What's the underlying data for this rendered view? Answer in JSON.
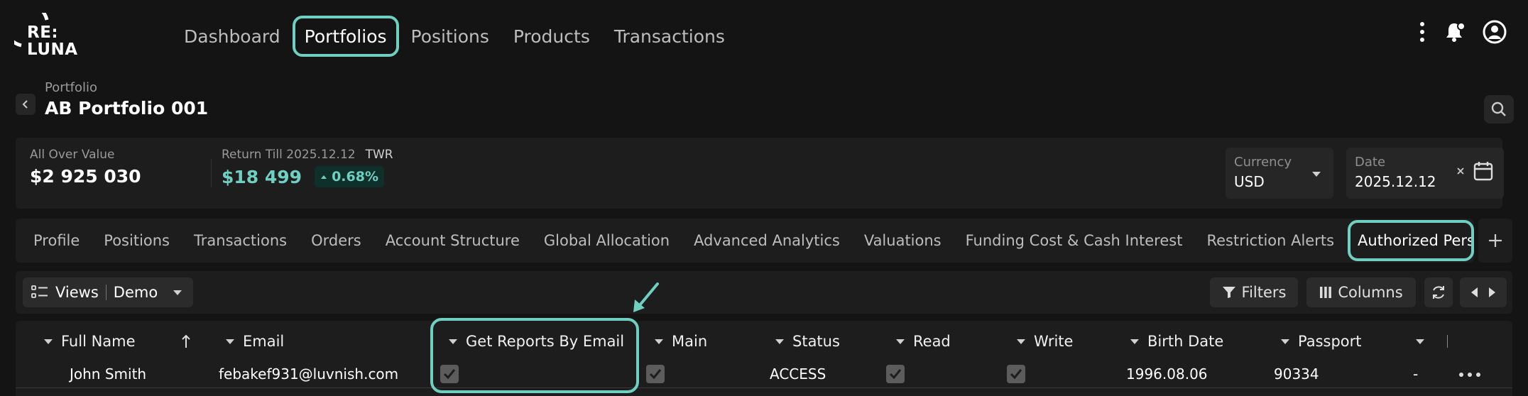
{
  "logo": {
    "line1": "RE:",
    "line2": "LUNA"
  },
  "nav": {
    "items": [
      "Dashboard",
      "Portfolios",
      "Positions",
      "Products",
      "Transactions"
    ],
    "active": "Portfolios"
  },
  "breadcrumb": {
    "parent": "Portfolio",
    "title": "AB Portfolio 001"
  },
  "summary": {
    "all_over_value_label": "All Over Value",
    "all_over_value": "$2 925 030",
    "return_label": "Return Till 2025.12.12",
    "return_type": "TWR",
    "return_value": "$18 499",
    "return_pct": "0.68%",
    "currency_label": "Currency",
    "currency_value": "USD",
    "date_label": "Date",
    "date_value": "2025.12.12"
  },
  "tabs": [
    "Profile",
    "Positions",
    "Transactions",
    "Orders",
    "Account Structure",
    "Global Allocation",
    "Advanced Analytics",
    "Valuations",
    "Funding Cost & Cash Interest",
    "Restriction Alerts",
    "Authorized Persons"
  ],
  "active_tab": "Authorized Persons",
  "toolbar": {
    "views_label": "Views",
    "views_value": "Demo",
    "filters_label": "Filters",
    "columns_label": "Columns"
  },
  "table": {
    "columns": [
      "Full Name",
      "Email",
      "Get Reports By Email",
      "Main",
      "Status",
      "Read",
      "Write",
      "Birth Date",
      "Passport"
    ],
    "rows": [
      {
        "full_name": "John Smith",
        "email": "febakef931@luvnish.com",
        "get_reports": true,
        "main": true,
        "status": "ACCESS",
        "read": true,
        "write": true,
        "birth_date": "1996.08.06",
        "passport": "90334",
        "extra": "-"
      }
    ]
  },
  "colors": {
    "accent": "#6fcfc0",
    "background": "#141414",
    "panel": "#1d1d1d"
  },
  "icons": [
    "more-vertical-icon",
    "notification-bell-icon",
    "user-avatar-icon",
    "back-chevron-icon",
    "search-icon",
    "caret-down-icon",
    "clear-icon",
    "calendar-icon",
    "plus-icon",
    "views-list-icon",
    "filter-icon",
    "columns-icon",
    "refresh-icon",
    "prev-arrow-icon",
    "next-arrow-icon",
    "sort-up-icon",
    "check-icon",
    "row-more-icon",
    "annotation-arrow-icon"
  ]
}
